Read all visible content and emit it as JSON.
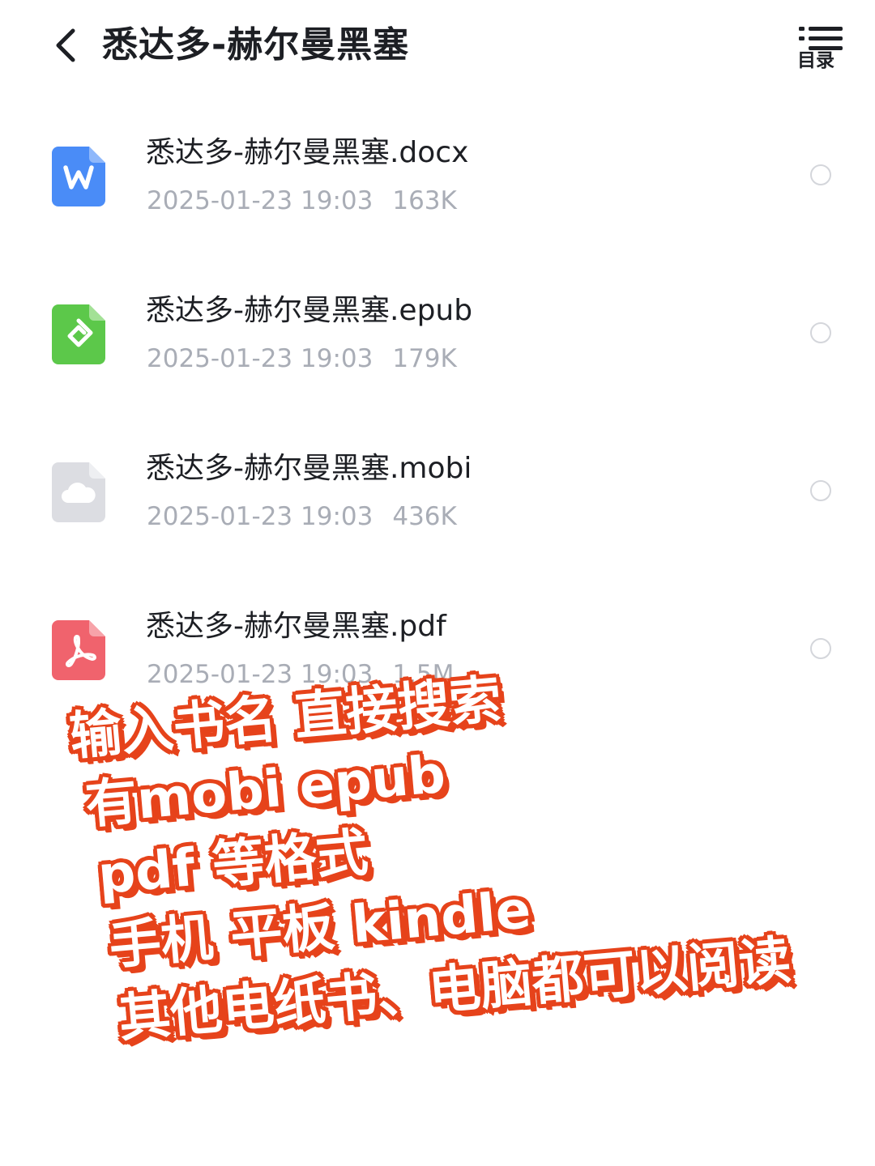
{
  "header": {
    "title": "悉达多-赫尔曼黑塞",
    "toc_label": "目录"
  },
  "colors": {
    "word": "#4a8cf7",
    "epub": "#5cc84a",
    "mobi": "#dcdde2",
    "pdf": "#f0636d",
    "caption_outline": "#e6431b"
  },
  "files": [
    {
      "name": "悉达多-赫尔曼黑塞.docx",
      "date": "2025-01-23 19:03",
      "size": "163K",
      "icon": "word-icon"
    },
    {
      "name": "悉达多-赫尔曼黑塞.epub",
      "date": "2025-01-23 19:03",
      "size": "179K",
      "icon": "epub-icon"
    },
    {
      "name": "悉达多-赫尔曼黑塞.mobi",
      "date": "2025-01-23 19:03",
      "size": "436K",
      "icon": "cloud-file-icon"
    },
    {
      "name": "悉达多-赫尔曼黑塞.pdf",
      "date": "2025-01-23 19:03",
      "size": "1.5M",
      "icon": "pdf-icon"
    }
  ],
  "overlay": {
    "line1": "输入书名  直接搜索",
    "line2": "有mobi  epub",
    "line3": "pdf  等格式",
    "line4": "手机  平板  kindle",
    "line5": "其他电纸书、电脑都可以阅读"
  }
}
